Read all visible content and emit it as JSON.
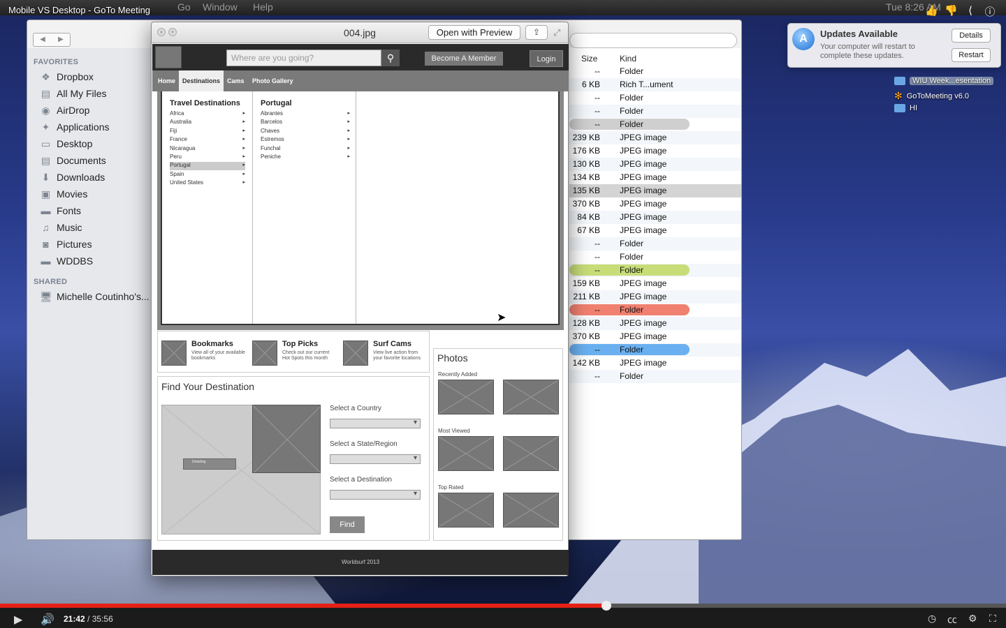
{
  "video": {
    "title": "Mobile VS Desktop - GoTo Meeting",
    "current_time": "21:42",
    "duration": "35:56",
    "progress_fraction": 0.603,
    "icons": [
      "like-icon",
      "dislike-icon",
      "share-icon",
      "info-icon"
    ]
  },
  "menubar": {
    "items": [
      "Go",
      "Window",
      "Help"
    ],
    "right": "Tue 8:26 AM"
  },
  "finder": {
    "sidebar": {
      "favorites_heading": "FAVORITES",
      "favorites": [
        {
          "label": "Dropbox",
          "icon": "dropbox-icon"
        },
        {
          "label": "All My Files",
          "icon": "files-icon"
        },
        {
          "label": "AirDrop",
          "icon": "airdrop-icon"
        },
        {
          "label": "Applications",
          "icon": "applications-icon"
        },
        {
          "label": "Desktop",
          "icon": "desktop-icon"
        },
        {
          "label": "Documents",
          "icon": "documents-icon"
        },
        {
          "label": "Downloads",
          "icon": "downloads-icon"
        },
        {
          "label": "Movies",
          "icon": "movies-icon"
        },
        {
          "label": "Fonts",
          "icon": "folder-icon"
        },
        {
          "label": "Music",
          "icon": "music-icon"
        },
        {
          "label": "Pictures",
          "icon": "pictures-icon"
        },
        {
          "label": "WDDBS",
          "icon": "folder-icon"
        }
      ],
      "shared_heading": "SHARED",
      "shared": [
        {
          "label": "Michelle Coutinho's...",
          "icon": "computer-icon"
        }
      ]
    },
    "columns": {
      "size": "Size",
      "kind": "Kind"
    },
    "rows": [
      {
        "size": "--",
        "kind": "Folder",
        "tag": ""
      },
      {
        "size": "6 KB",
        "kind": "Rich T...ument",
        "tag": ""
      },
      {
        "size": "--",
        "kind": "Folder",
        "tag": ""
      },
      {
        "size": "--",
        "kind": "Folder",
        "tag": ""
      },
      {
        "size": "--",
        "kind": "Folder",
        "tag": "#cfcfcf"
      },
      {
        "size": "239 KB",
        "kind": "JPEG image",
        "tag": ""
      },
      {
        "size": "176 KB",
        "kind": "JPEG image",
        "tag": ""
      },
      {
        "size": "130 KB",
        "kind": "JPEG image",
        "tag": ""
      },
      {
        "size": "134 KB",
        "kind": "JPEG image",
        "tag": ""
      },
      {
        "size": "135 KB",
        "kind": "JPEG image",
        "tag": "sel"
      },
      {
        "size": "370 KB",
        "kind": "JPEG image",
        "tag": ""
      },
      {
        "size": "84 KB",
        "kind": "JPEG image",
        "tag": ""
      },
      {
        "size": "67 KB",
        "kind": "JPEG image",
        "tag": ""
      },
      {
        "size": "--",
        "kind": "Folder",
        "tag": ""
      },
      {
        "size": "--",
        "kind": "Folder",
        "tag": ""
      },
      {
        "size": "--",
        "kind": "Folder",
        "tag": "#c8dc78"
      },
      {
        "size": "159 KB",
        "kind": "JPEG image",
        "tag": ""
      },
      {
        "size": "211 KB",
        "kind": "JPEG image",
        "tag": ""
      },
      {
        "size": "--",
        "kind": "Folder",
        "tag": "#f08070"
      },
      {
        "size": "128 KB",
        "kind": "JPEG image",
        "tag": ""
      },
      {
        "size": "370 KB",
        "kind": "JPEG image",
        "tag": ""
      },
      {
        "size": "--",
        "kind": "Folder",
        "tag": "#6ab0f0"
      },
      {
        "size": "142 KB",
        "kind": "JPEG image",
        "tag": ""
      },
      {
        "size": "--",
        "kind": "Folder",
        "tag": ""
      }
    ]
  },
  "preview": {
    "filename": "004.jpg",
    "open_with": "Open with Preview",
    "wireframe": {
      "search_placeholder": "Where are you going?",
      "member_btn": "Become A Member",
      "login_btn": "Login",
      "nav": [
        "Home",
        "Destinations",
        "Cams",
        "Photo Gallery"
      ],
      "mega": {
        "col1_head": "Travel Destinations",
        "col1": [
          "Africa",
          "Australia",
          "Fiji",
          "France",
          "Nicaragua",
          "Peru",
          "Portugal",
          "Spain",
          "United States"
        ],
        "col2_head": "Portugal",
        "col2": [
          "Abrantes",
          "Barcelos",
          "Chaves",
          "Estremos",
          "Funchal",
          "Peniche"
        ],
        "selected": "Portugal"
      },
      "features": [
        {
          "title": "Bookmarks",
          "sub": "View all of your available bookmarks"
        },
        {
          "title": "Top Picks",
          "sub": "Check out our current Hot Spots this month"
        },
        {
          "title": "Surf Cams",
          "sub": "View live action from your favorite locations"
        }
      ],
      "find": {
        "heading": "Find Your Destination",
        "labels": [
          "Select a Country",
          "Select a State/Region",
          "Select a Destination"
        ],
        "button": "Find",
        "map_pin": "Detailing"
      },
      "photos": {
        "heading": "Photos",
        "sections": [
          "Recently Added",
          "Most Viewed",
          "Top Rated"
        ]
      },
      "footer": "Worldsurf 2013"
    }
  },
  "notification": {
    "title": "Updates Available",
    "text": "Your computer will restart to complete these updates.",
    "details": "Details",
    "restart": "Restart"
  },
  "desktop_items": [
    {
      "label": "WIU Week...esentation",
      "highlighted": true
    },
    {
      "label": "GoToMeeting v6.0",
      "highlighted": false
    },
    {
      "label": "HI",
      "highlighted": false
    }
  ]
}
